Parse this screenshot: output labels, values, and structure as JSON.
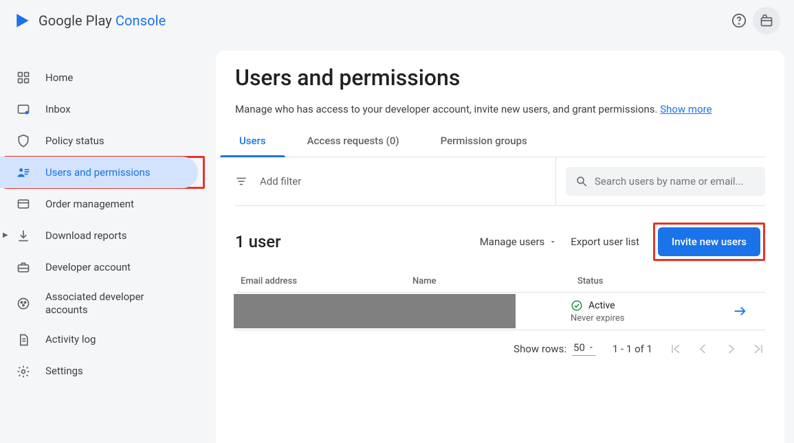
{
  "brand": {
    "name1": "Google Play ",
    "name2": "Console"
  },
  "sidebar": {
    "items": [
      {
        "label": "Home"
      },
      {
        "label": "Inbox"
      },
      {
        "label": "Policy status"
      },
      {
        "label": "Users and permissions"
      },
      {
        "label": "Order management"
      },
      {
        "label": "Download reports"
      },
      {
        "label": "Developer account"
      },
      {
        "label": "Associated developer accounts"
      },
      {
        "label": "Activity log"
      },
      {
        "label": "Settings"
      }
    ]
  },
  "page": {
    "title": "Users and permissions",
    "subtitle": "Manage who has access to your developer account, invite new users, and grant permissions.  ",
    "show_more": "Show more"
  },
  "tabs": {
    "users": "Users",
    "access": "Access requests (0)",
    "groups": "Permission groups"
  },
  "filter": {
    "add": "Add filter",
    "search_placeholder": "Search users by name or email..."
  },
  "section": {
    "count_label": "1 user",
    "manage": "Manage users",
    "export": "Export user list",
    "invite": "Invite new users"
  },
  "table": {
    "headers": {
      "email": "Email address",
      "name": "Name",
      "status": "Status"
    },
    "rows": [
      {
        "status": "Active",
        "expires": "Never expires"
      }
    ]
  },
  "pager": {
    "show_rows": "Show rows:",
    "rows_value": "50",
    "range": "1 - 1 of 1"
  }
}
